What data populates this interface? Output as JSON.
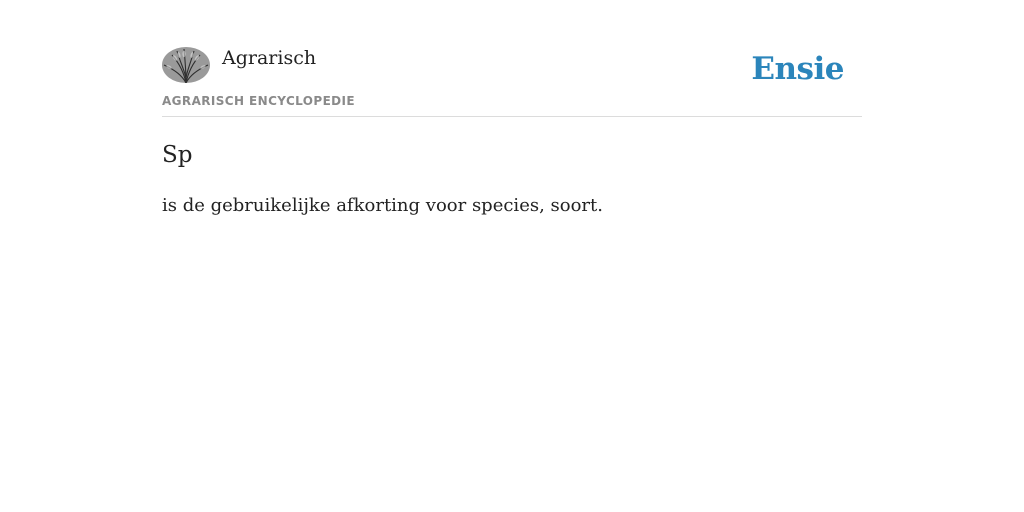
{
  "header": {
    "logo_icon": "wheat-plant-logo-icon",
    "site_name": "Agrarisch",
    "subtitle": "AGRARISCH ENCYCLOPEDIE",
    "brand": "Ensie"
  },
  "colors": {
    "brand": "#2b85bb",
    "subtitle": "#8a8a8a",
    "text": "#222222",
    "divider": "#dcdcdc"
  },
  "entry": {
    "title": "Sp",
    "text": "is de gebruikelijke afkorting voor species, soort."
  }
}
